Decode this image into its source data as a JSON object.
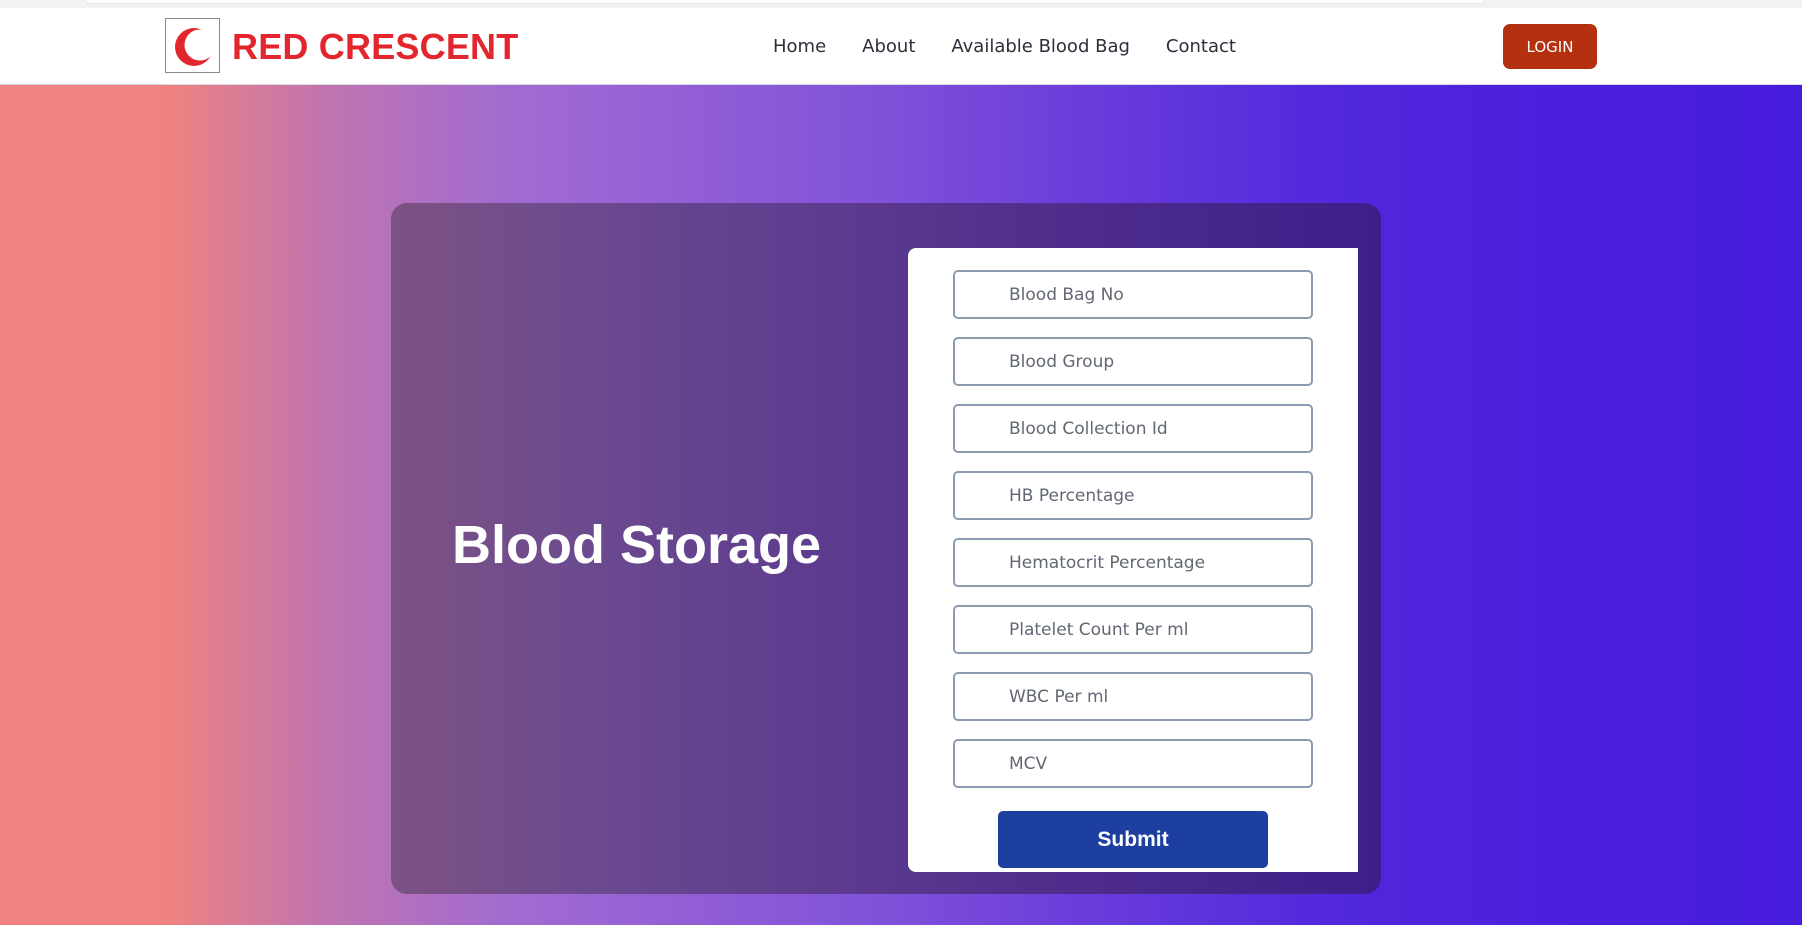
{
  "header": {
    "brand": "RED CRESCENT",
    "logo_icon": "red-crescent-icon",
    "brand_color": "#e3262d",
    "nav": [
      {
        "label": "Home"
      },
      {
        "label": "About"
      },
      {
        "label": "Available Blood Bag"
      },
      {
        "label": "Contact"
      }
    ],
    "login_label": "LOGIN",
    "login_color": "#b5300e"
  },
  "main": {
    "title": "Blood Storage",
    "form": {
      "fields": [
        {
          "placeholder": "Blood Bag No"
        },
        {
          "placeholder": "Blood Group"
        },
        {
          "placeholder": "Blood Collection Id"
        },
        {
          "placeholder": "HB Percentage"
        },
        {
          "placeholder": "Hematocrit Percentage"
        },
        {
          "placeholder": "Platelet Count Per ml"
        },
        {
          "placeholder": "WBC Per ml"
        },
        {
          "placeholder": "MCV"
        }
      ],
      "submit_label": "Submit",
      "submit_color": "#1d3fa0"
    }
  }
}
